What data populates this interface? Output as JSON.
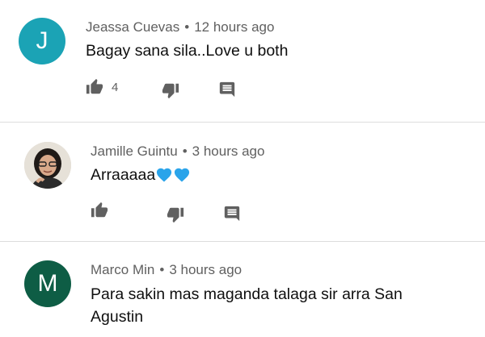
{
  "comments": [
    {
      "author": "Jeassa Cuevas",
      "time": "12 hours ago",
      "text": "Bagay sana sila..Love u both",
      "avatar_letter": "J",
      "avatar_color": "#1ba3b5",
      "likes": "4"
    },
    {
      "author": "Jamille Guintu",
      "time": "3 hours ago",
      "text": "Arraaaaa",
      "avatar_letter": "",
      "avatar_color": "#d8d2c8",
      "emoji_hearts": 2,
      "heart_color": "#2aa4ea"
    },
    {
      "author": "Marco Min",
      "time": "3 hours ago",
      "text": "Para sakin mas maganda talaga sir arra San Agustin",
      "avatar_letter": "M",
      "avatar_color": "#0e5d45"
    }
  ],
  "separator": "•",
  "icon_color": "#606060"
}
